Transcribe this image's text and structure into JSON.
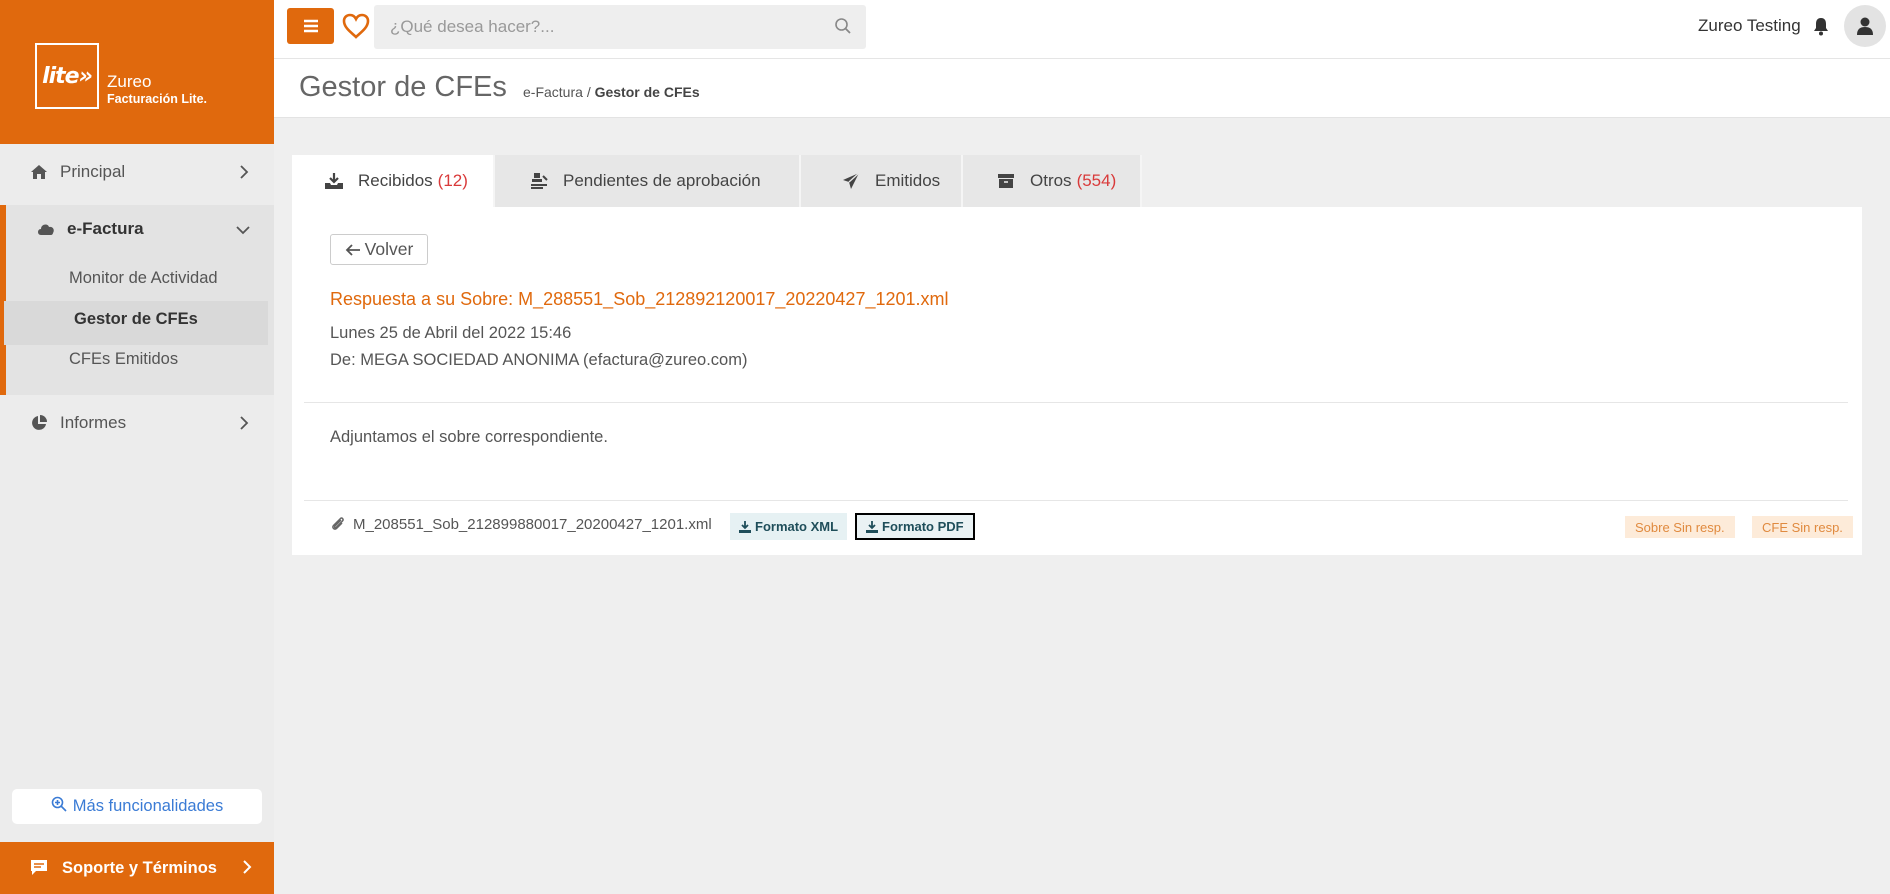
{
  "brand": {
    "logo_text": "lite»",
    "name": "Zureo",
    "subtitle": "Facturación Lite."
  },
  "sidebar": {
    "items": [
      {
        "label": "Principal",
        "icon": "home-icon"
      },
      {
        "label": "e-Factura",
        "icon": "cloud-icon"
      },
      {
        "label": "Informes",
        "icon": "pie-chart-icon"
      }
    ],
    "efactura_subitems": [
      {
        "label": "Monitor de Actividad",
        "active": false
      },
      {
        "label": "Gestor de CFEs",
        "active": true
      },
      {
        "label": "CFEs Emitidos",
        "active": false
      }
    ],
    "more_label": "Más funcionalidades",
    "support_label": "Soporte y Términos"
  },
  "topbar": {
    "search_placeholder": "¿Qué desea hacer?...",
    "user_name": "Zureo Testing"
  },
  "page": {
    "title": "Gestor de CFEs",
    "breadcrumb_parent": "e-Factura",
    "breadcrumb_sep": "/",
    "breadcrumb_current": "Gestor de CFEs"
  },
  "tabs": [
    {
      "label": "Recibidos",
      "count": "(12)",
      "icon": "inbox-download-icon",
      "active": true
    },
    {
      "label": "Pendientes de aprobación",
      "count": "",
      "icon": "stamp-icon",
      "active": false
    },
    {
      "label": "Emitidos",
      "count": "",
      "icon": "paper-plane-icon",
      "active": false
    },
    {
      "label": "Otros",
      "count": "(554)",
      "icon": "archive-icon",
      "active": false
    }
  ],
  "message": {
    "back_label": "Volver",
    "subject": "Respuesta a su Sobre: M_288551_Sob_212892120017_20220427_1201.xml",
    "date": "Lunes 25 de Abril del 2022 15:46",
    "from": "De: MEGA SOCIEDAD ANONIMA (efactura@zureo.com)",
    "body": "Adjuntamos el sobre correspondiente.",
    "attachment_name": "M_208551_Sob_212899880017_20200427_1201.xml",
    "xml_button": "Formato XML",
    "pdf_button": "Formato PDF",
    "badge_sobre": "Sobre Sin resp.",
    "badge_cfe": "CFE Sin resp."
  },
  "colors": {
    "accent": "#e0690d",
    "count_red": "#d93a3a",
    "link_blue": "#3a7bd5"
  }
}
